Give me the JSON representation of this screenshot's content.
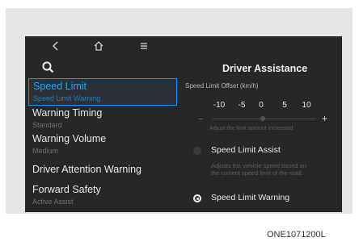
{
  "nav": {
    "back_icon": "back-chevron-icon",
    "home_icon": "home-icon",
    "menu_icon": "menu-icon",
    "search_icon": "search-icon"
  },
  "list": [
    {
      "title": "Speed Limit",
      "subtitle": "Speed Limit Warning",
      "selected": true
    },
    {
      "title": "Warning Timing",
      "subtitle": "Standard",
      "selected": false
    },
    {
      "title": "Warning Volume",
      "subtitle": "Medium",
      "selected": false
    },
    {
      "title": "Driver Attention Warning",
      "subtitle": "",
      "selected": false
    },
    {
      "title": "Forward Safety",
      "subtitle": "Active Assist",
      "selected": false
    }
  ],
  "panel": {
    "title": "Driver Assistance",
    "offset_label": "Speed Limit Offset (km/h)",
    "offset_values": [
      "-10",
      "-5",
      "0",
      "5",
      "10"
    ],
    "minus": "−",
    "plus": "+",
    "offset_hint": "Adjust the limit amount increased",
    "assist_label": "Speed Limit Assist",
    "assist_description": "Adjusts the vehicle speed based on the current speed limit of the road.",
    "warning_label": "Speed Limit Warning",
    "warning_selected": true
  },
  "image_code": "ONE1071200L",
  "colors": {
    "screen": "#27272a",
    "accent": "#1e8ee0",
    "frame": "#e6e6e6"
  }
}
